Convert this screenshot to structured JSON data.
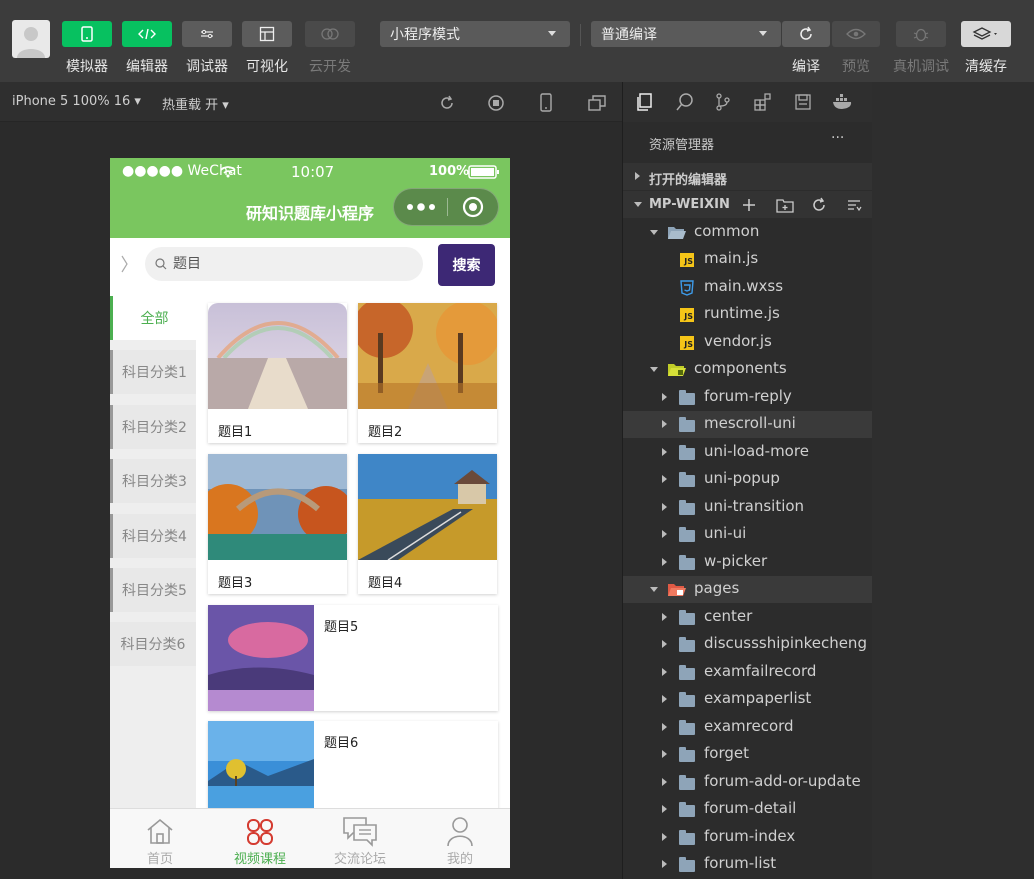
{
  "toolbar": {
    "buttons": [
      {
        "label": "模拟器"
      },
      {
        "label": "编辑器"
      },
      {
        "label": "调试器"
      },
      {
        "label": "可视化"
      },
      {
        "label": "云开发"
      }
    ],
    "mode_select": "小程序模式",
    "compile_select": "普通编译",
    "right_buttons": [
      {
        "label": "编译"
      },
      {
        "label": "预览"
      },
      {
        "label": "真机调试"
      },
      {
        "label": "清缓存"
      }
    ]
  },
  "subbar": {
    "device": "iPhone 5 100% 16",
    "hot_reload": "热重载 开"
  },
  "phone": {
    "status": {
      "carrier": "●●●●● WeChat",
      "time": "10:07",
      "battery": "100%"
    },
    "nav_title": "研知识题库小程序",
    "search_placeholder": "题目",
    "search_button": "搜索",
    "categories": [
      "全部",
      "科目分类1",
      "科目分类2",
      "科目分类3",
      "科目分类4",
      "科目分类5",
      "科目分类6"
    ],
    "items": [
      "题目1",
      "题目2",
      "题目3",
      "题目4",
      "题目5",
      "题目6"
    ],
    "tabs": [
      "首页",
      "视频课程",
      "交流论坛",
      "我的"
    ]
  },
  "explorer": {
    "title": "资源管理器",
    "more": "···",
    "open_editors": "打开的编辑器",
    "project": "MP-WEIXIN",
    "tree": {
      "common": "common",
      "main_js": "main.js",
      "main_wxss": "main.wxss",
      "runtime_js": "runtime.js",
      "vendor_js": "vendor.js",
      "components": "components",
      "forum_reply": "forum-reply",
      "mescroll_uni": "mescroll-uni",
      "uni_load_more": "uni-load-more",
      "uni_popup": "uni-popup",
      "uni_transition": "uni-transition",
      "uni_ui": "uni-ui",
      "w_picker": "w-picker",
      "pages": "pages",
      "center": "center",
      "discuss": "discussshipinkecheng",
      "examfailrecord": "examfailrecord",
      "exampaperlist": "exampaperlist",
      "examrecord": "examrecord",
      "forget": "forget",
      "forum_add": "forum-add-or-update",
      "forum_detail": "forum-detail",
      "forum_index": "forum-index",
      "forum_list": "forum-list"
    }
  },
  "colors": {
    "accent_green": "#07c160",
    "nav_green": "#7ac65f",
    "search_purple": "#3d2875"
  }
}
